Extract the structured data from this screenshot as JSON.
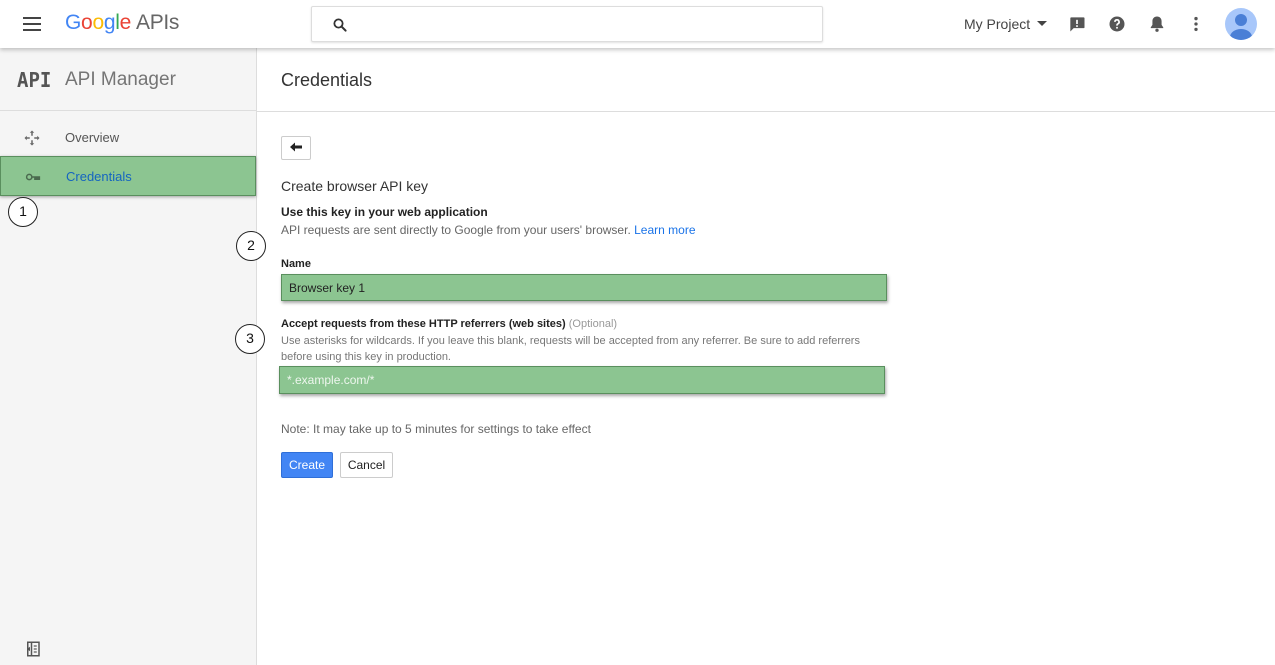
{
  "header": {
    "logo_chars": [
      "G",
      "o",
      "o",
      "g",
      "l",
      "e"
    ],
    "logo_suffix": "APIs",
    "search_placeholder": "",
    "project_name": "My Project",
    "icons": [
      "menu-icon",
      "search-icon",
      "feedback-icon",
      "help-icon",
      "notifications-icon",
      "more-vert-icon",
      "account-avatar"
    ]
  },
  "sidebar": {
    "logo_text": "API",
    "title": "API Manager",
    "items": [
      {
        "label": "Overview",
        "icon": "overview-icon",
        "active": false
      },
      {
        "label": "Credentials",
        "icon": "key-icon",
        "active": true
      }
    ],
    "collapse_icon": "collapse-sidebar-icon"
  },
  "main": {
    "page_title": "Credentials",
    "form_title": "Create browser API key",
    "subheading": "Use this key in your web application",
    "description": "API requests are sent directly to Google from your users' browser.",
    "learn_more": "Learn more",
    "name_label": "Name",
    "name_value": "Browser key 1",
    "referrers_label": "Accept requests from these HTTP referrers (web sites)",
    "referrers_optional": "(Optional)",
    "referrers_hint": "Use asterisks for wildcards. If you leave this blank, requests will be accepted from any referrer. Be sure to add referrers before using this key in production.",
    "referrers_placeholder": "*.example.com/*",
    "note": "Note: It may take up to 5 minutes for settings to take effect",
    "create_label": "Create",
    "cancel_label": "Cancel"
  },
  "annotations": [
    "1",
    "2",
    "3"
  ],
  "colors": {
    "highlight_green": "#8cc591",
    "primary_blue": "#4285f4",
    "link_blue": "#1a73e8"
  }
}
